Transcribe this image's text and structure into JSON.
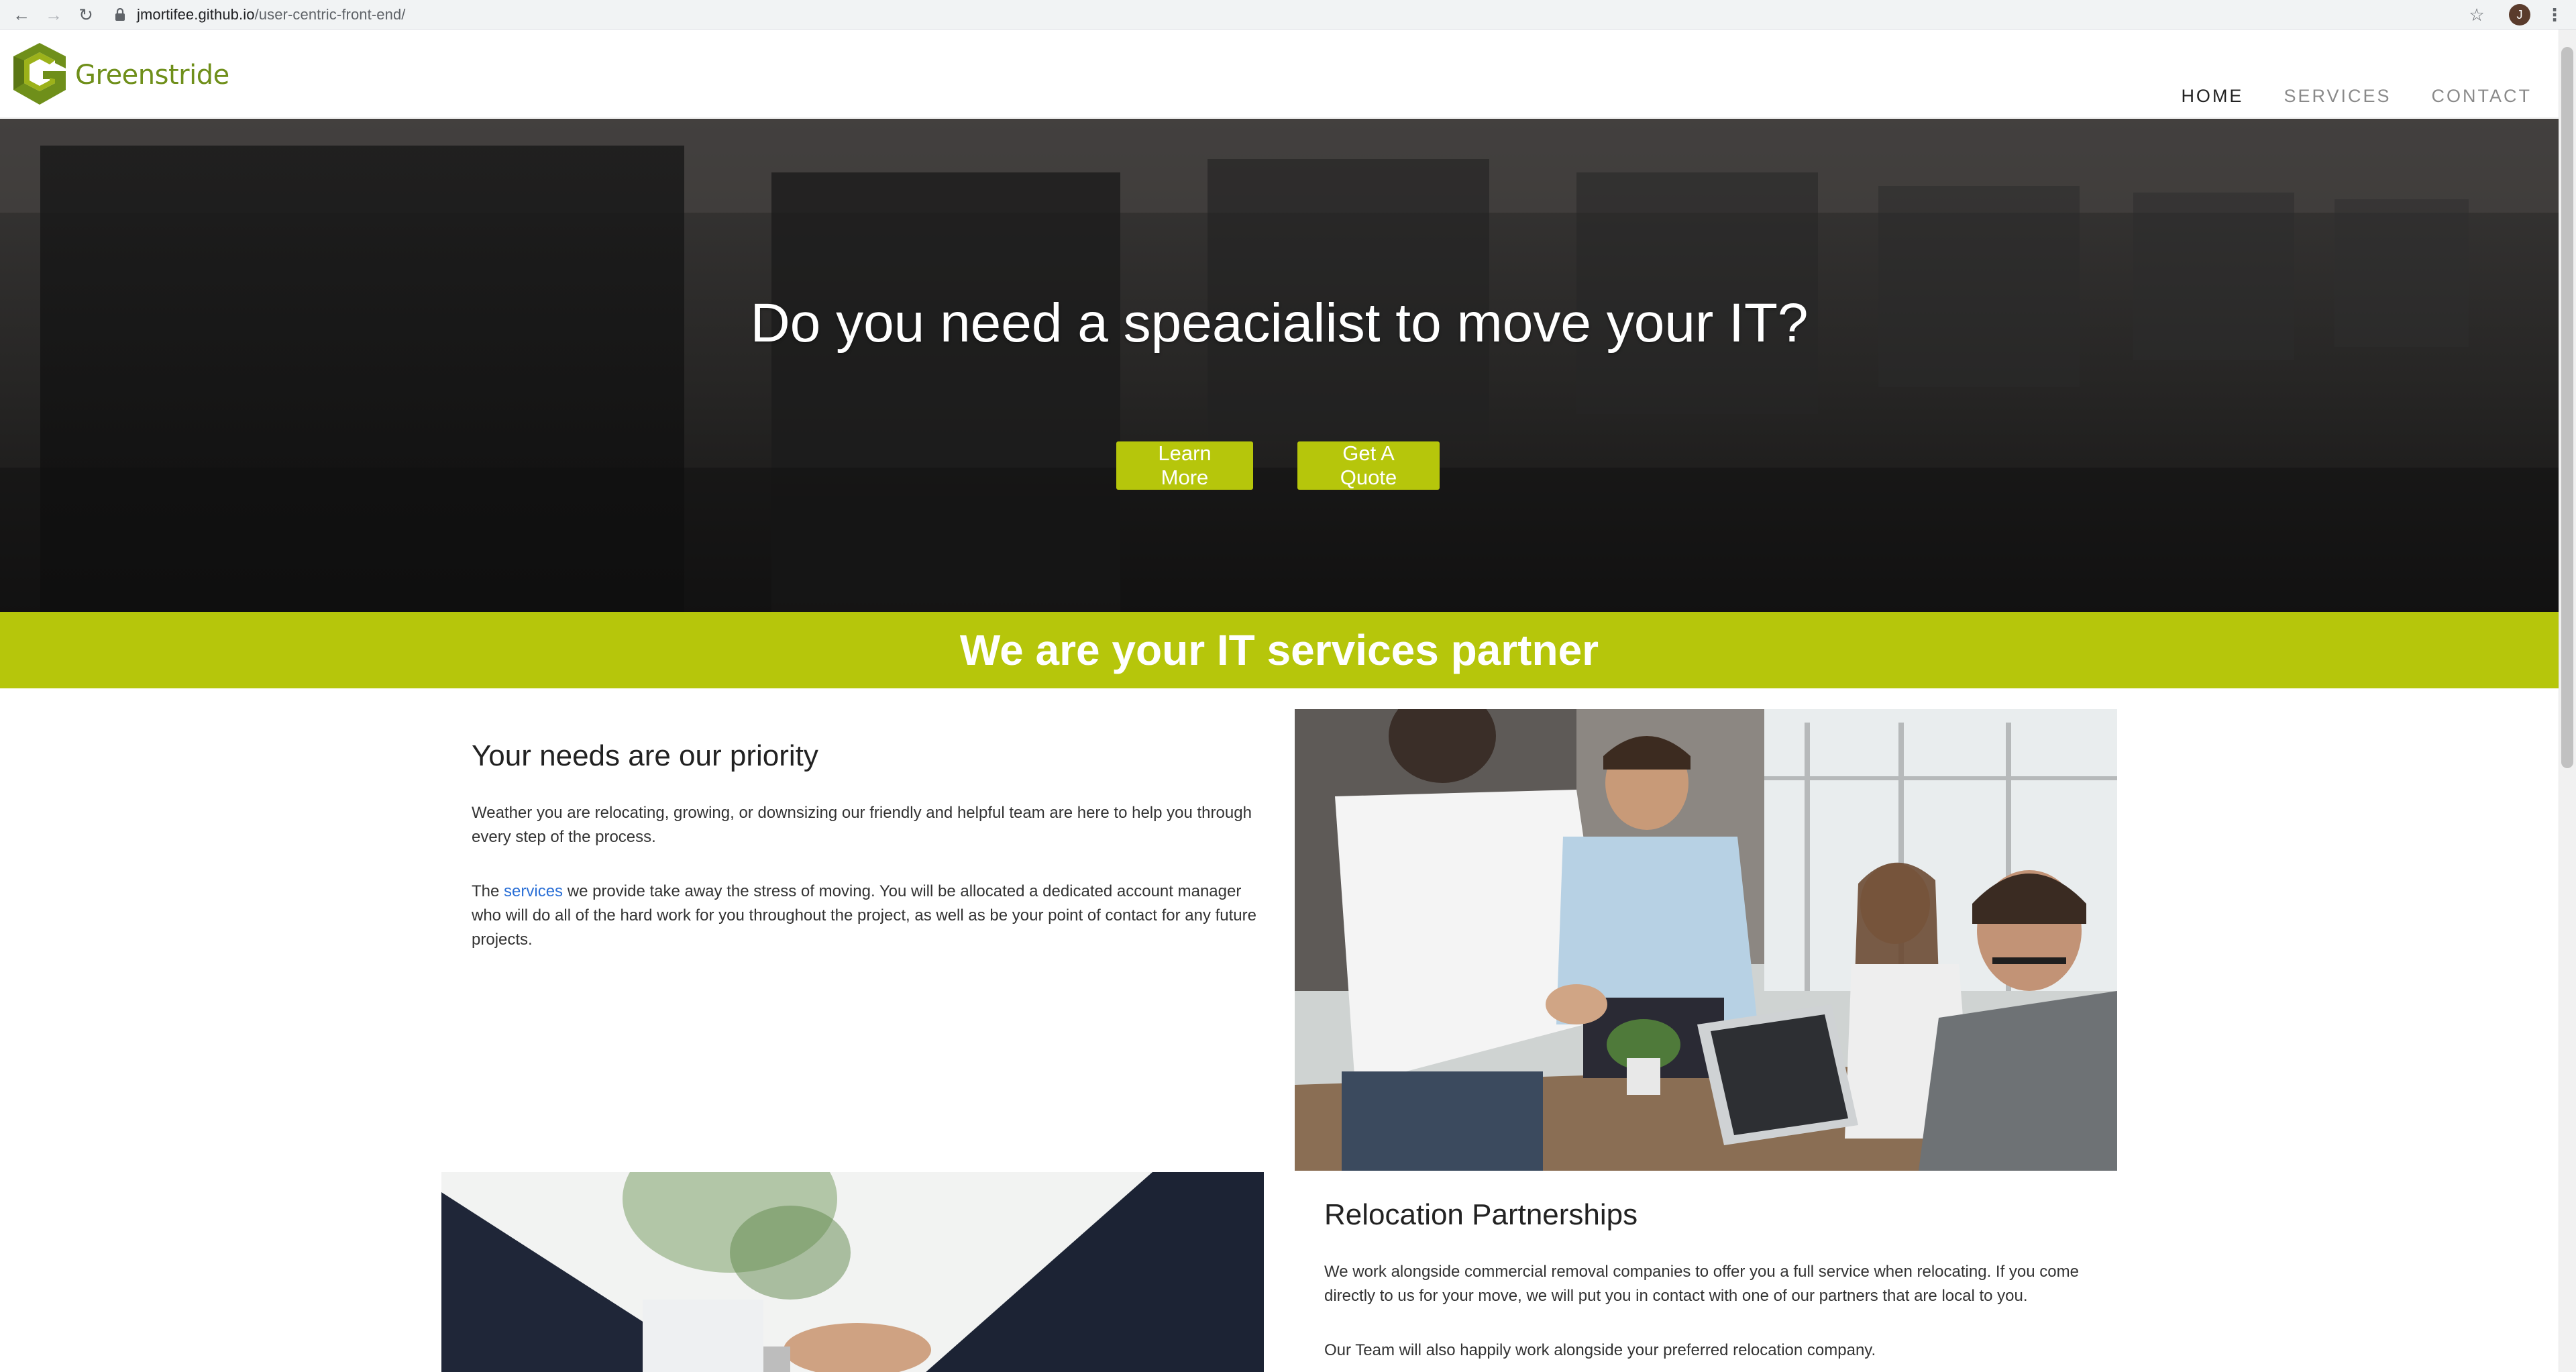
{
  "browser": {
    "url_host": "jmortifee.github.io",
    "url_path": "/user-centric-front-end/",
    "profile_initial": "J"
  },
  "header": {
    "logo_text": "Greenstride",
    "nav": [
      {
        "label": "HOME",
        "active": true
      },
      {
        "label": "SERVICES",
        "active": false
      },
      {
        "label": "CONTACT",
        "active": false
      }
    ]
  },
  "hero": {
    "title": "Do you need a speacialist to move your IT?",
    "learn_more": "Learn More",
    "get_quote": "Get A Quote"
  },
  "banner": {
    "title": "We are your IT services partner"
  },
  "priority": {
    "heading": "Your needs are our priority",
    "para1": "Weather you are relocating, growing, or downsizing our friendly and helpful team are here to help you through every step of the process.",
    "para2_prefix": "The ",
    "para2_link": "services",
    "para2_suffix": " we provide take away the stress of moving. You will be allocated a dedicated account manager who will do all of the hard work for you throughout the project, as well as be your point of contact for any future projects."
  },
  "relocation": {
    "heading": "Relocation Partnerships",
    "para1": "We work alongside commercial removal companies to offer you a full service when relocating. If you come directly to us for your move, we will put you in contact with one of our partners that are local to you.",
    "para2": "Our Team will also happily work alongside your preferred relocation company."
  },
  "colors": {
    "brand_green": "#b6c60b",
    "logo_green": "#6f8f1a",
    "link_blue": "#2a6fd6"
  },
  "icons": {
    "back": "arrow-left-icon",
    "forward": "arrow-right-icon",
    "reload": "reload-icon",
    "lock": "lock-icon",
    "star": "star-icon",
    "menu": "kebab-menu-icon"
  }
}
